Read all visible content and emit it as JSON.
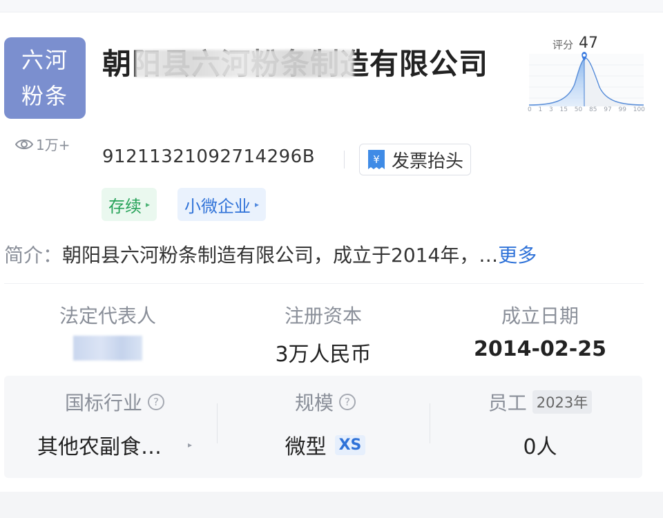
{
  "logo": {
    "line1": "六河",
    "line2": "粉条",
    "color": "#7b8fcf"
  },
  "views": "1万+",
  "company": {
    "name": "朝阳县六河粉条制造有限公司",
    "credit_code": "91211321092714296B",
    "invoice_label": "发票抬头",
    "tags": [
      {
        "label": "存续"
      },
      {
        "label": "小微企业"
      }
    ]
  },
  "score": {
    "label": "评分",
    "value": "47",
    "axis_ticks": [
      "0",
      "1",
      "3",
      "15",
      "50",
      "85",
      "97",
      "99",
      "100"
    ]
  },
  "intro": {
    "label": "简介：",
    "text": "朝阳县六河粉条制造有限公司，成立于2014年，…",
    "more": "更多"
  },
  "stats": [
    {
      "label": "法定代表人",
      "value": ""
    },
    {
      "label": "注册资本",
      "value": "3万人民币"
    },
    {
      "label": "成立日期",
      "value": "2014-02-25"
    }
  ],
  "details": [
    {
      "label": "国标行业",
      "value": "其他农副食…"
    },
    {
      "label": "规模",
      "value": "微型",
      "badge": "XS"
    },
    {
      "label": "员工",
      "year": "2023年",
      "value": "0人"
    }
  ],
  "colors": {
    "accent": "#2f72d8",
    "green": "#28a35a",
    "muted": "#8a8f99"
  }
}
